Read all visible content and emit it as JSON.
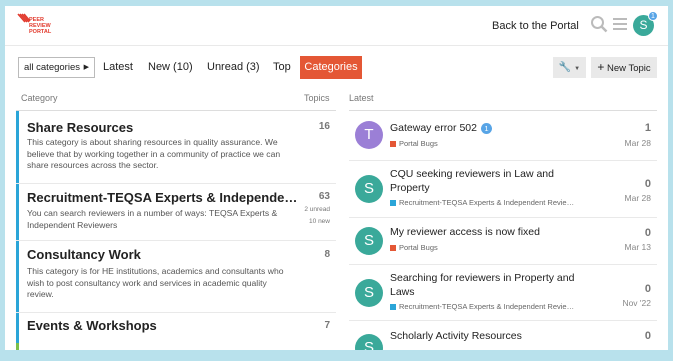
{
  "colors": {
    "accent": "#e45735",
    "teal_avatar": "#3aa99a",
    "purple_avatar": "#9b7fd6",
    "blue_badge": "#57a4e6",
    "portal_bugs": "#e45735",
    "recruitment": "#2aa5d8"
  },
  "header": {
    "logo_line1": "PEER",
    "logo_line2": "REVIEW",
    "logo_line3": "PORTAL",
    "back_link": "Back to the Portal",
    "avatar_letter": "S",
    "notification_count": "1"
  },
  "nav": {
    "category_dropdown": "all categories",
    "items": [
      "Latest",
      "New (10)",
      "Unread (3)",
      "Top",
      "Categories"
    ],
    "new_topic": "New Topic",
    "wrench_icon": "wrench-icon"
  },
  "columns": {
    "category": "Category",
    "topics": "Topics",
    "latest": "Latest"
  },
  "categories": [
    {
      "name": "Share Resources",
      "description": "This category is about sharing resources in quality assurance. We believe that by working together in a community of practice we can share resources across the sector.",
      "topics": "16",
      "color": "#2aa5d8"
    },
    {
      "name": "Recruitment-TEQSA Experts & Independe…",
      "description": "You can search reviewers in a number of ways: TEQSA Experts & Independent Reviewers",
      "topics": "63",
      "unread": "2 unread",
      "new": "10 new",
      "color": "#2aa5d8"
    },
    {
      "name": "Consultancy Work",
      "description": "This category is for HE institutions, academics and consultants who wish to post consultancy work and services in academic quality review.",
      "topics": "8",
      "color": "#2aa5d8"
    },
    {
      "name": "Events & Workshops",
      "description": "",
      "topics": "7",
      "color": "#2aa5d8"
    }
  ],
  "latest": [
    {
      "avatar": "T",
      "title": "Gateway error 502",
      "badge": "1",
      "tag": "Portal Bugs",
      "count": "1",
      "date": "Mar 28"
    },
    {
      "avatar": "S",
      "title": "CQU seeking reviewers in Law and Property",
      "tag": "Recruitment-TEQSA Experts & Independent Revie…",
      "count": "0",
      "date": "Mar 28"
    },
    {
      "avatar": "S",
      "title": "My reviewer access is now fixed",
      "tag": "Portal Bugs",
      "count": "0",
      "date": "Mar 13"
    },
    {
      "avatar": "S",
      "title": "Searching for reviewers in Property and Laws",
      "tag": "Recruitment-TEQSA Experts & Independent Revie…",
      "count": "0",
      "date": "Nov '22"
    },
    {
      "avatar": "S",
      "title": "Scholarly Activity Resources",
      "count": "0"
    }
  ]
}
